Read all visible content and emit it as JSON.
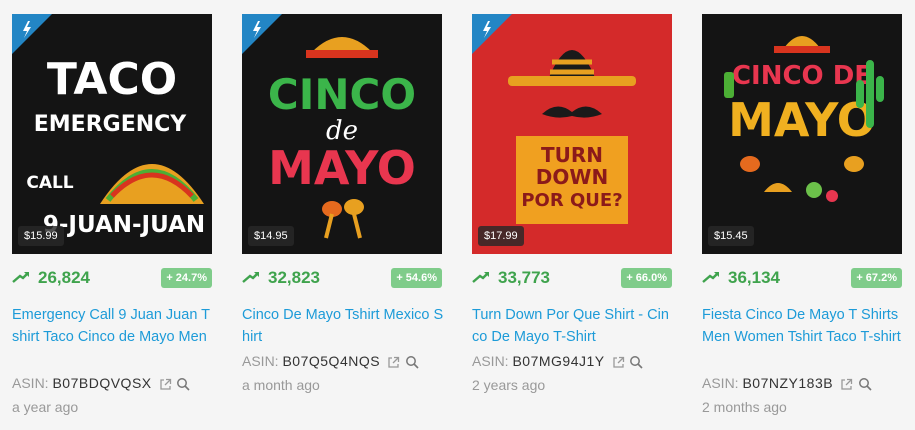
{
  "colors": {
    "accent_blue": "#1d9bd8",
    "trend_green": "#3fa34d",
    "badge_bg": "#cfe9d2",
    "ribbon": "#2386c5"
  },
  "products": [
    {
      "price": "$15.99",
      "rank": "26,824",
      "change": "+ 24.7%",
      "title": "Emergency Call 9 Juan Juan T shirt Taco Cinco de Mayo Men",
      "asin_label": "ASIN:",
      "asin": "B07BDQVQSX",
      "age": "a year ago",
      "art_lines": [
        "TACO",
        "EMERGENCY",
        "CALL",
        "9-JUAN-JUAN"
      ]
    },
    {
      "price": "$14.95",
      "rank": "32,823",
      "change": "+ 54.6%",
      "title": "Cinco De Mayo Tshirt Mexico Shirt",
      "asin_label": "ASIN:",
      "asin": "B07Q5Q4NQS",
      "age": "a month ago",
      "art_lines": [
        "CINCO",
        "de",
        "MAYO"
      ]
    },
    {
      "price": "$17.99",
      "rank": "33,773",
      "change": "+ 66.0%",
      "title": "Turn Down Por Que Shirt - Cinco De Mayo T-Shirt",
      "asin_label": "ASIN:",
      "asin": "B07MG94J1Y",
      "age": "2 years ago",
      "art_lines": [
        "TURN",
        "DOWN",
        "POR QUE?"
      ]
    },
    {
      "price": "$15.45",
      "rank": "36,134",
      "change": "+ 67.2%",
      "title": "Fiesta Cinco De Mayo T Shirts Men Women Tshirt Taco T-shirt",
      "asin_label": "ASIN:",
      "asin": "B07NZY183B",
      "age": "2 months ago",
      "art_lines": [
        "CINCO DE",
        "MAYO"
      ]
    }
  ]
}
